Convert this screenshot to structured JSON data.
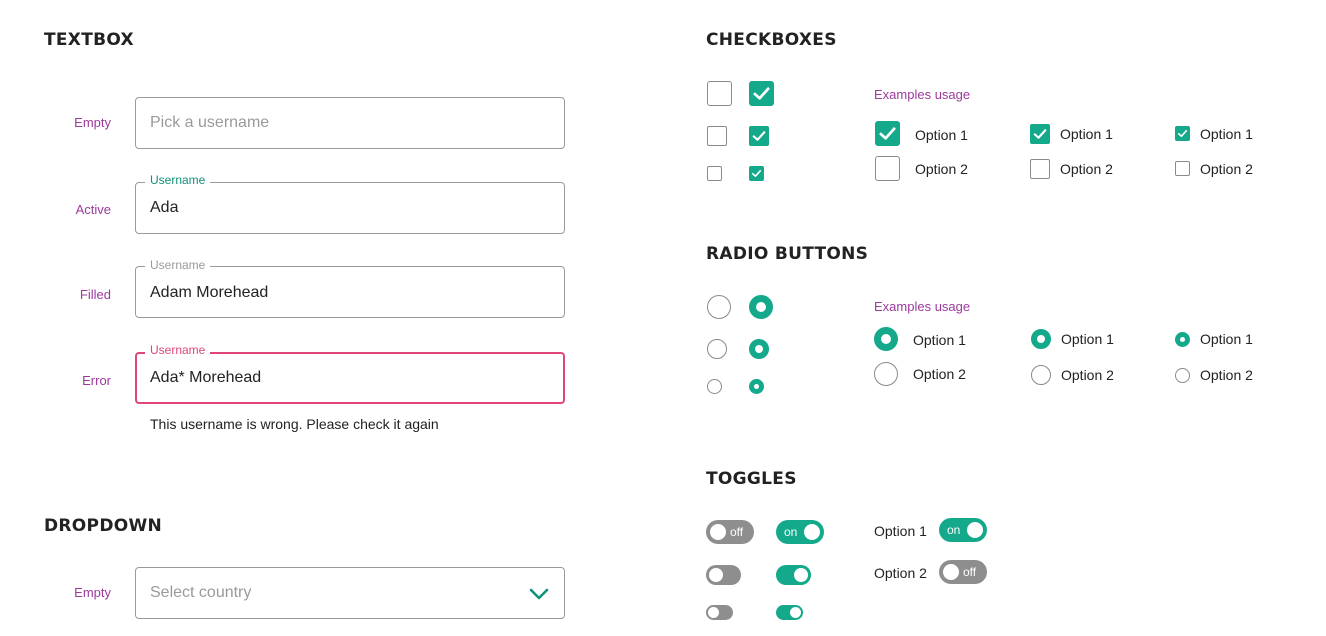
{
  "textbox": {
    "title": "TEXTBOX",
    "rows": [
      {
        "state": "Empty",
        "placeholder": "Pick a username"
      },
      {
        "state": "Active",
        "label": "Username",
        "value": "Ada"
      },
      {
        "state": "Filled",
        "label": "Username",
        "value": "Adam Morehead"
      },
      {
        "state": "Error",
        "label": "Username",
        "value": "Ada* Morehead",
        "helper": "This username is wrong. Please check it again"
      }
    ]
  },
  "dropdown": {
    "title": "DROPDOWN",
    "rows": [
      {
        "state": "Empty",
        "placeholder": "Select country",
        "icon": "chevron-down-icon"
      }
    ]
  },
  "checkboxes": {
    "title": "CHECKBOXES",
    "examples_label": "Examples usage",
    "groups": [
      {
        "options": [
          {
            "label": "Option 1",
            "checked": true
          },
          {
            "label": "Option 2",
            "checked": false
          }
        ]
      },
      {
        "options": [
          {
            "label": "Option 1",
            "checked": true
          },
          {
            "label": "Option 2",
            "checked": false
          }
        ]
      },
      {
        "options": [
          {
            "label": "Option 1",
            "checked": true
          },
          {
            "label": "Option 2",
            "checked": false
          }
        ]
      }
    ]
  },
  "radio_buttons": {
    "title": "RADIO BUTTONS",
    "examples_label": "Examples usage",
    "groups": [
      {
        "options": [
          {
            "label": "Option 1",
            "selected": true
          },
          {
            "label": "Option 2",
            "selected": false
          }
        ]
      },
      {
        "options": [
          {
            "label": "Option 1",
            "selected": true
          },
          {
            "label": "Option 2",
            "selected": false
          }
        ]
      },
      {
        "options": [
          {
            "label": "Option 1",
            "selected": true
          },
          {
            "label": "Option 2",
            "selected": false
          }
        ]
      }
    ]
  },
  "toggles": {
    "title": "TOGGLES",
    "off_text": "off",
    "on_text": "on",
    "examples": [
      {
        "label": "Option 1",
        "on": true
      },
      {
        "label": "Option 2",
        "on": false
      }
    ]
  },
  "colors": {
    "accent": "#14a98b",
    "state_label": "#9c3a9c",
    "error": "#e0457b",
    "toggle_off": "#8e8e8e"
  }
}
